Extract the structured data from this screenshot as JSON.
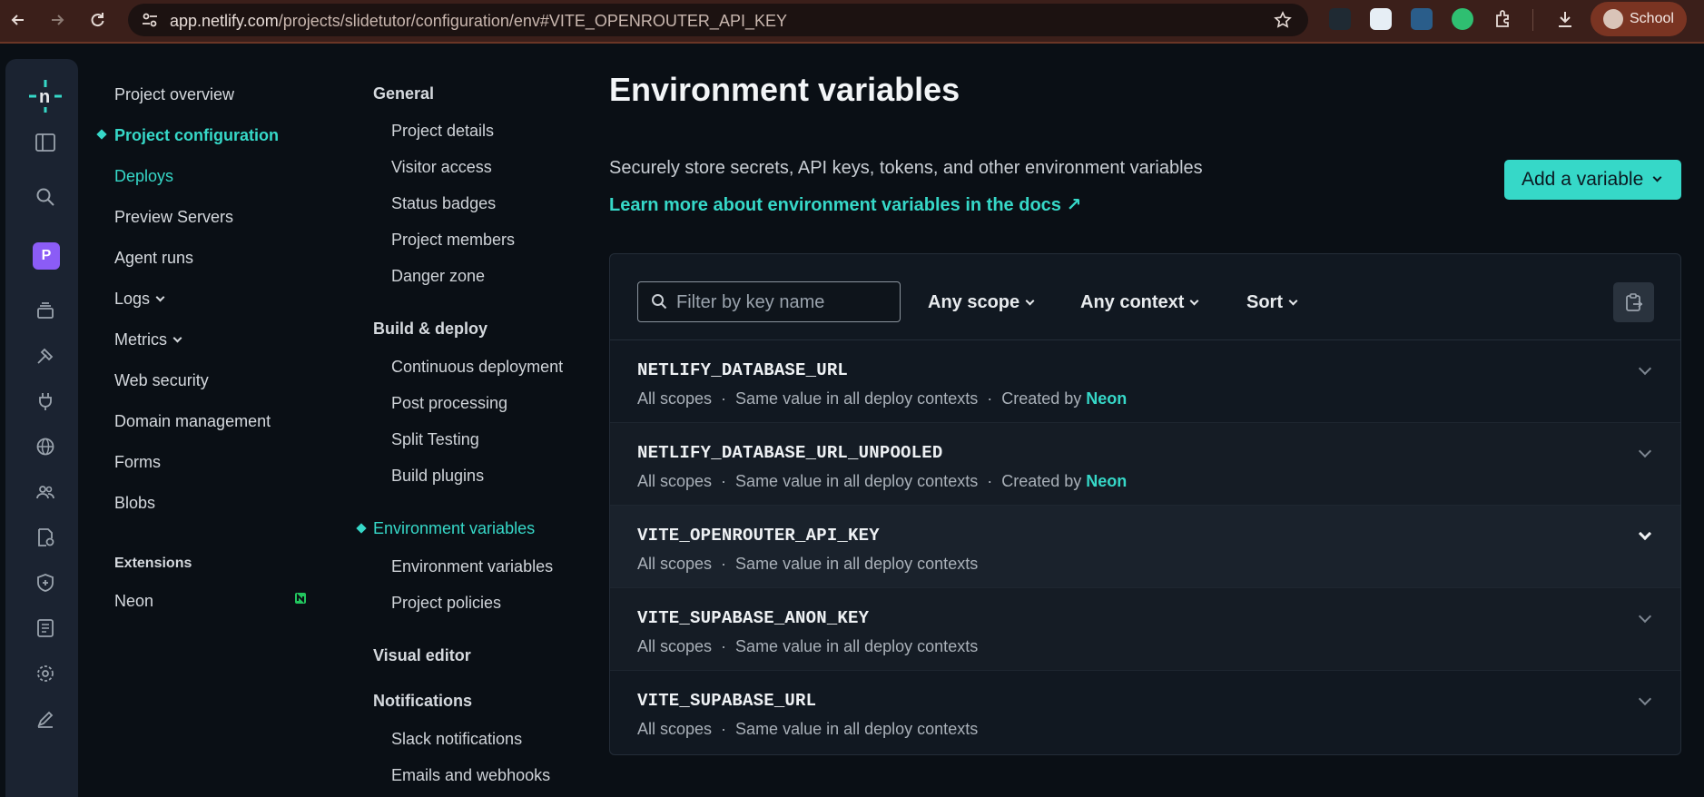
{
  "browser": {
    "url_host": "app.netlify.com",
    "url_path": "/projects/slidetutor/configuration/env#VITE_OPENROUTER_API_KEY",
    "profile_name": "School",
    "colors": {
      "chrome_bg": "#3b1f1a",
      "url_bg": "#1c1211",
      "profile_bg": "#7a3422"
    }
  },
  "rail": {
    "project_badge": "P",
    "icons": [
      "netlify-logo-icon",
      "sidebar-toggle-icon",
      "search-icon",
      "project-badge",
      "layers-icon",
      "hammer-icon",
      "plug-icon",
      "globe-icon",
      "team-icon",
      "security-scan-icon",
      "shield-icon",
      "ledger-icon",
      "gear-icon",
      "edit-icon"
    ]
  },
  "primary_nav": {
    "items": [
      {
        "label": "Project overview"
      },
      {
        "label": "Project configuration",
        "active": true
      },
      {
        "label": "Deploys"
      },
      {
        "label": "Preview Servers"
      },
      {
        "label": "Agent runs"
      },
      {
        "label": "Logs"
      },
      {
        "label": "Metrics"
      },
      {
        "label": "Web security"
      },
      {
        "label": "Domain management"
      },
      {
        "label": "Forms"
      },
      {
        "label": "Blobs"
      }
    ],
    "extensions_heading": "Extensions",
    "extensions": [
      {
        "label": "Neon"
      }
    ]
  },
  "config_nav": {
    "general": {
      "heading": "General",
      "items": [
        "Project details",
        "Visitor access",
        "Status badges",
        "Project members",
        "Danger zone"
      ]
    },
    "build": {
      "heading": "Build & deploy",
      "items": [
        "Continuous deployment",
        "Post processing",
        "Split Testing",
        "Build plugins"
      ]
    },
    "env": {
      "heading": "Environment variables",
      "items": [
        "Environment variables",
        "Project policies"
      ]
    },
    "visual_editor": {
      "heading": "Visual editor"
    },
    "notifications": {
      "heading": "Notifications",
      "items": [
        "Slack notifications",
        "Emails and webhooks"
      ]
    }
  },
  "main": {
    "title": "Environment variables",
    "description": "Securely store secrets, API keys, tokens, and other environment variables",
    "docs_link": "Learn more about environment variables in the docs ↗",
    "add_button": "Add a variable",
    "filter_placeholder": "Filter by key name",
    "dropdowns": {
      "scope": "Any scope",
      "context": "Any context",
      "sort": "Sort"
    },
    "variables": [
      {
        "key": "NETLIFY_DATABASE_URL",
        "scopes": "All scopes",
        "contexts": "Same value in all deploy contexts",
        "created_by_label": "Created by",
        "created_by": "Neon"
      },
      {
        "key": "NETLIFY_DATABASE_URL_UNPOOLED",
        "scopes": "All scopes",
        "contexts": "Same value in all deploy contexts",
        "created_by_label": "Created by",
        "created_by": "Neon"
      },
      {
        "key": "VITE_OPENROUTER_API_KEY",
        "scopes": "All scopes",
        "contexts": "Same value in all deploy contexts",
        "highlighted": true
      },
      {
        "key": "VITE_SUPABASE_ANON_KEY",
        "scopes": "All scopes",
        "contexts": "Same value in all deploy contexts"
      },
      {
        "key": "VITE_SUPABASE_URL",
        "scopes": "All scopes",
        "contexts": "Same value in all deploy contexts"
      }
    ],
    "colors": {
      "accent": "#36d8c8",
      "bg": "#0a0f15",
      "panel": "#111821"
    }
  }
}
